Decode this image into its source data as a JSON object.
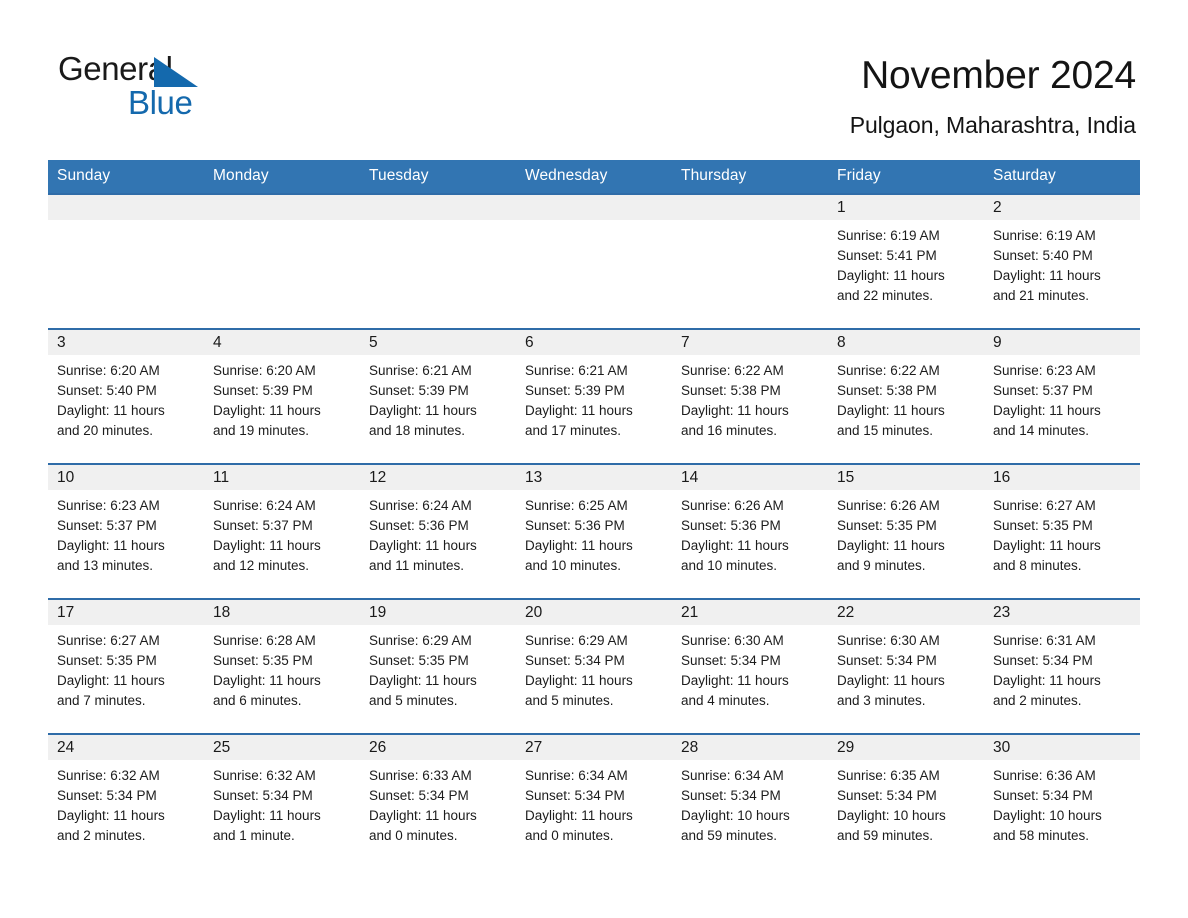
{
  "logo": {
    "word1": "General",
    "word2": "Blue",
    "accent_color": "#1469ad",
    "triangle_icon": "triangle-icon"
  },
  "header": {
    "title": "November 2024",
    "subtitle": "Pulgaon, Maharashtra, India"
  },
  "theme": {
    "header_blue": "#3275b2",
    "row_border_blue": "#2f6ca8",
    "daynum_strip": "#f0f0f0",
    "text": "#1c1c1c"
  },
  "weekdays": [
    {
      "label": "Sunday"
    },
    {
      "label": "Monday"
    },
    {
      "label": "Tuesday"
    },
    {
      "label": "Wednesday"
    },
    {
      "label": "Thursday"
    },
    {
      "label": "Friday"
    },
    {
      "label": "Saturday"
    }
  ],
  "weeks": [
    {
      "days": [
        {
          "num": "",
          "empty": true,
          "sunrise": "",
          "sunset": "",
          "daylight1": "",
          "daylight2": ""
        },
        {
          "num": "",
          "empty": true,
          "sunrise": "",
          "sunset": "",
          "daylight1": "",
          "daylight2": ""
        },
        {
          "num": "",
          "empty": true,
          "sunrise": "",
          "sunset": "",
          "daylight1": "",
          "daylight2": ""
        },
        {
          "num": "",
          "empty": true,
          "sunrise": "",
          "sunset": "",
          "daylight1": "",
          "daylight2": ""
        },
        {
          "num": "",
          "empty": true,
          "sunrise": "",
          "sunset": "",
          "daylight1": "",
          "daylight2": ""
        },
        {
          "num": "1",
          "empty": false,
          "sunrise": "Sunrise: 6:19 AM",
          "sunset": "Sunset: 5:41 PM",
          "daylight1": "Daylight: 11 hours",
          "daylight2": "and 22 minutes."
        },
        {
          "num": "2",
          "empty": false,
          "sunrise": "Sunrise: 6:19 AM",
          "sunset": "Sunset: 5:40 PM",
          "daylight1": "Daylight: 11 hours",
          "daylight2": "and 21 minutes."
        }
      ]
    },
    {
      "days": [
        {
          "num": "3",
          "empty": false,
          "sunrise": "Sunrise: 6:20 AM",
          "sunset": "Sunset: 5:40 PM",
          "daylight1": "Daylight: 11 hours",
          "daylight2": "and 20 minutes."
        },
        {
          "num": "4",
          "empty": false,
          "sunrise": "Sunrise: 6:20 AM",
          "sunset": "Sunset: 5:39 PM",
          "daylight1": "Daylight: 11 hours",
          "daylight2": "and 19 minutes."
        },
        {
          "num": "5",
          "empty": false,
          "sunrise": "Sunrise: 6:21 AM",
          "sunset": "Sunset: 5:39 PM",
          "daylight1": "Daylight: 11 hours",
          "daylight2": "and 18 minutes."
        },
        {
          "num": "6",
          "empty": false,
          "sunrise": "Sunrise: 6:21 AM",
          "sunset": "Sunset: 5:39 PM",
          "daylight1": "Daylight: 11 hours",
          "daylight2": "and 17 minutes."
        },
        {
          "num": "7",
          "empty": false,
          "sunrise": "Sunrise: 6:22 AM",
          "sunset": "Sunset: 5:38 PM",
          "daylight1": "Daylight: 11 hours",
          "daylight2": "and 16 minutes."
        },
        {
          "num": "8",
          "empty": false,
          "sunrise": "Sunrise: 6:22 AM",
          "sunset": "Sunset: 5:38 PM",
          "daylight1": "Daylight: 11 hours",
          "daylight2": "and 15 minutes."
        },
        {
          "num": "9",
          "empty": false,
          "sunrise": "Sunrise: 6:23 AM",
          "sunset": "Sunset: 5:37 PM",
          "daylight1": "Daylight: 11 hours",
          "daylight2": "and 14 minutes."
        }
      ]
    },
    {
      "days": [
        {
          "num": "10",
          "empty": false,
          "sunrise": "Sunrise: 6:23 AM",
          "sunset": "Sunset: 5:37 PM",
          "daylight1": "Daylight: 11 hours",
          "daylight2": "and 13 minutes."
        },
        {
          "num": "11",
          "empty": false,
          "sunrise": "Sunrise: 6:24 AM",
          "sunset": "Sunset: 5:37 PM",
          "daylight1": "Daylight: 11 hours",
          "daylight2": "and 12 minutes."
        },
        {
          "num": "12",
          "empty": false,
          "sunrise": "Sunrise: 6:24 AM",
          "sunset": "Sunset: 5:36 PM",
          "daylight1": "Daylight: 11 hours",
          "daylight2": "and 11 minutes."
        },
        {
          "num": "13",
          "empty": false,
          "sunrise": "Sunrise: 6:25 AM",
          "sunset": "Sunset: 5:36 PM",
          "daylight1": "Daylight: 11 hours",
          "daylight2": "and 10 minutes."
        },
        {
          "num": "14",
          "empty": false,
          "sunrise": "Sunrise: 6:26 AM",
          "sunset": "Sunset: 5:36 PM",
          "daylight1": "Daylight: 11 hours",
          "daylight2": "and 10 minutes."
        },
        {
          "num": "15",
          "empty": false,
          "sunrise": "Sunrise: 6:26 AM",
          "sunset": "Sunset: 5:35 PM",
          "daylight1": "Daylight: 11 hours",
          "daylight2": "and 9 minutes."
        },
        {
          "num": "16",
          "empty": false,
          "sunrise": "Sunrise: 6:27 AM",
          "sunset": "Sunset: 5:35 PM",
          "daylight1": "Daylight: 11 hours",
          "daylight2": "and 8 minutes."
        }
      ]
    },
    {
      "days": [
        {
          "num": "17",
          "empty": false,
          "sunrise": "Sunrise: 6:27 AM",
          "sunset": "Sunset: 5:35 PM",
          "daylight1": "Daylight: 11 hours",
          "daylight2": "and 7 minutes."
        },
        {
          "num": "18",
          "empty": false,
          "sunrise": "Sunrise: 6:28 AM",
          "sunset": "Sunset: 5:35 PM",
          "daylight1": "Daylight: 11 hours",
          "daylight2": "and 6 minutes."
        },
        {
          "num": "19",
          "empty": false,
          "sunrise": "Sunrise: 6:29 AM",
          "sunset": "Sunset: 5:35 PM",
          "daylight1": "Daylight: 11 hours",
          "daylight2": "and 5 minutes."
        },
        {
          "num": "20",
          "empty": false,
          "sunrise": "Sunrise: 6:29 AM",
          "sunset": "Sunset: 5:34 PM",
          "daylight1": "Daylight: 11 hours",
          "daylight2": "and 5 minutes."
        },
        {
          "num": "21",
          "empty": false,
          "sunrise": "Sunrise: 6:30 AM",
          "sunset": "Sunset: 5:34 PM",
          "daylight1": "Daylight: 11 hours",
          "daylight2": "and 4 minutes."
        },
        {
          "num": "22",
          "empty": false,
          "sunrise": "Sunrise: 6:30 AM",
          "sunset": "Sunset: 5:34 PM",
          "daylight1": "Daylight: 11 hours",
          "daylight2": "and 3 minutes."
        },
        {
          "num": "23",
          "empty": false,
          "sunrise": "Sunrise: 6:31 AM",
          "sunset": "Sunset: 5:34 PM",
          "daylight1": "Daylight: 11 hours",
          "daylight2": "and 2 minutes."
        }
      ]
    },
    {
      "days": [
        {
          "num": "24",
          "empty": false,
          "sunrise": "Sunrise: 6:32 AM",
          "sunset": "Sunset: 5:34 PM",
          "daylight1": "Daylight: 11 hours",
          "daylight2": "and 2 minutes."
        },
        {
          "num": "25",
          "empty": false,
          "sunrise": "Sunrise: 6:32 AM",
          "sunset": "Sunset: 5:34 PM",
          "daylight1": "Daylight: 11 hours",
          "daylight2": "and 1 minute."
        },
        {
          "num": "26",
          "empty": false,
          "sunrise": "Sunrise: 6:33 AM",
          "sunset": "Sunset: 5:34 PM",
          "daylight1": "Daylight: 11 hours",
          "daylight2": "and 0 minutes."
        },
        {
          "num": "27",
          "empty": false,
          "sunrise": "Sunrise: 6:34 AM",
          "sunset": "Sunset: 5:34 PM",
          "daylight1": "Daylight: 11 hours",
          "daylight2": "and 0 minutes."
        },
        {
          "num": "28",
          "empty": false,
          "sunrise": "Sunrise: 6:34 AM",
          "sunset": "Sunset: 5:34 PM",
          "daylight1": "Daylight: 10 hours",
          "daylight2": "and 59 minutes."
        },
        {
          "num": "29",
          "empty": false,
          "sunrise": "Sunrise: 6:35 AM",
          "sunset": "Sunset: 5:34 PM",
          "daylight1": "Daylight: 10 hours",
          "daylight2": "and 59 minutes."
        },
        {
          "num": "30",
          "empty": false,
          "sunrise": "Sunrise: 6:36 AM",
          "sunset": "Sunset: 5:34 PM",
          "daylight1": "Daylight: 10 hours",
          "daylight2": "and 58 minutes."
        }
      ]
    }
  ]
}
